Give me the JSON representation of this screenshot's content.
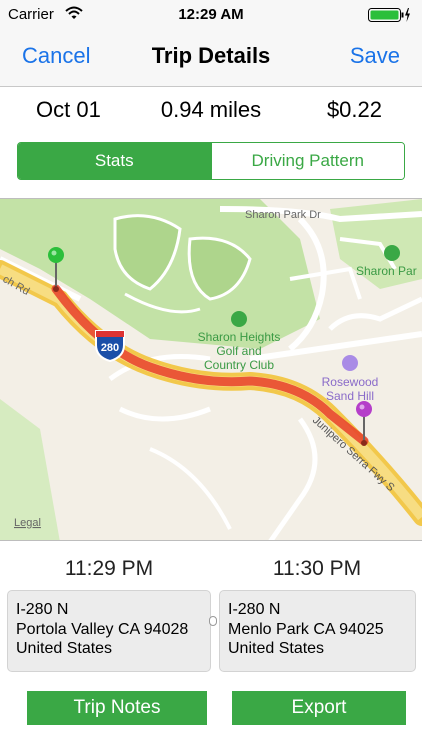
{
  "status_bar": {
    "carrier": "Carrier",
    "time": "12:29 AM"
  },
  "nav": {
    "cancel_label": "Cancel",
    "title": "Trip Details",
    "save_label": "Save"
  },
  "summary": {
    "date": "Oct 01",
    "distance": "0.94 miles",
    "cost": "$0.22"
  },
  "segments": {
    "active": "Stats",
    "inactive": "Driving Pattern"
  },
  "map": {
    "street_sharon_park": "Sharon Park Dr",
    "street_rd": "ch Rd",
    "street_junipero": "Junipero Serra Fwy S",
    "highway_shield": "280",
    "poi_golf_line1": "Sharon Heights",
    "poi_golf_line2": "Golf and",
    "poi_golf_line3": "Country Club",
    "poi_hotel_line1": "Rosewood",
    "poi_hotel_line2": "Sand Hill",
    "poi_park": "Sharon Par",
    "legal": "Legal",
    "colors": {
      "route": "#e8402a",
      "start_pin": "#2bbf3b",
      "end_pin": "#b53ec9"
    }
  },
  "trip": {
    "start": {
      "time": "11:29 PM",
      "line1": "I-280 N",
      "line2": "Portola Valley CA 94028",
      "line3": "United States"
    },
    "end": {
      "time": "11:30 PM",
      "line1": "I-280 N",
      "line2": "Menlo Park CA 94025",
      "line3": "United States"
    }
  },
  "buttons": {
    "notes": "Trip Notes",
    "export": "Export"
  },
  "colors": {
    "accent_green": "#3aa845",
    "link_blue": "#1a73e8"
  }
}
